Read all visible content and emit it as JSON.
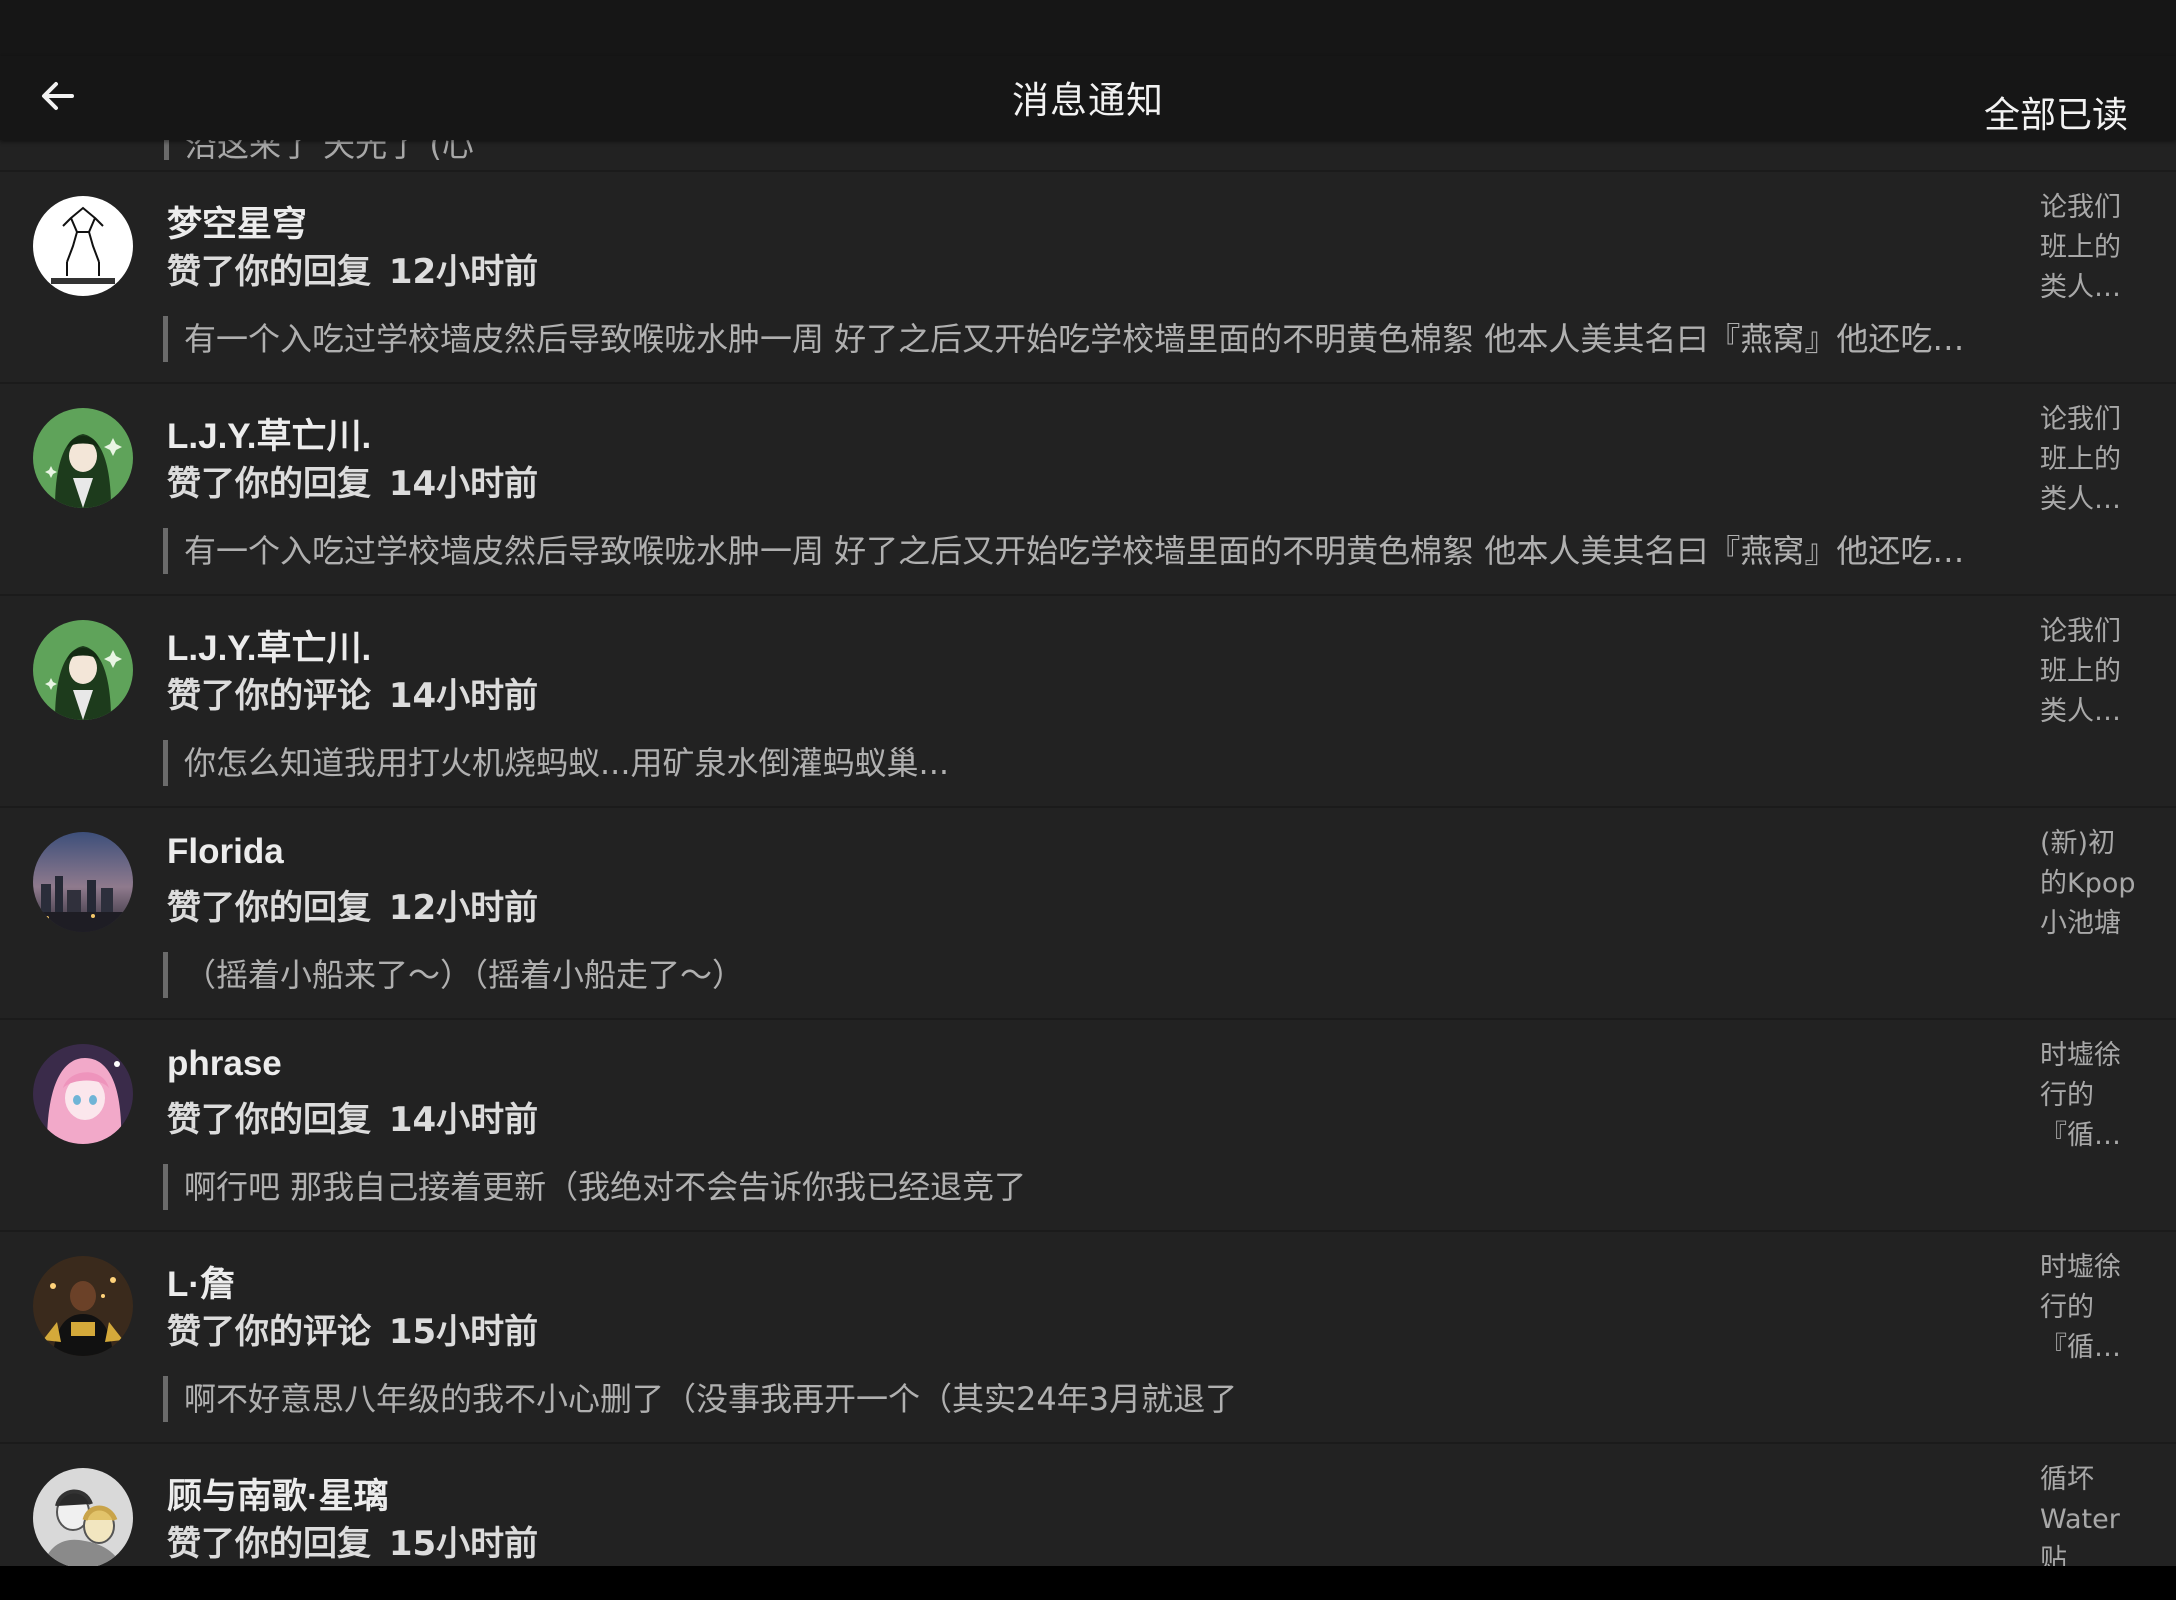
{
  "header": {
    "title": "消息通知",
    "mark_all_read": "全部已读",
    "back_icon": "arrow-left-icon"
  },
  "partial_item": {
    "quote": "沿这来了 天光了 (心"
  },
  "notifications": [
    {
      "avatar": "sketch-logo-avatar",
      "username": "梦空星穹",
      "action": "赞了你的回复",
      "time": "12小时前",
      "quote": "有一个入吃过学校墙皮然后导致喉咙水肿一周 好了之后又开始吃学校墙里面的不明黄色棉絮 他本人美其名曰『燕窝』他还吃…",
      "source": "论我们\n班上的\n类人…"
    },
    {
      "avatar": "green-anime-avatar",
      "username": "L.J.Y.草亡川.",
      "action": "赞了你的回复",
      "time": "14小时前",
      "quote": "有一个入吃过学校墙皮然后导致喉咙水肿一周 好了之后又开始吃学校墙里面的不明黄色棉絮 他本人美其名曰『燕窝』他还吃…",
      "source": "论我们\n班上的\n类人…"
    },
    {
      "avatar": "green-anime-avatar",
      "username": "L.J.Y.草亡川.",
      "action": "赞了你的评论",
      "time": "14小时前",
      "quote": "你怎么知道我用打火机烧蚂蚁...用矿泉水倒灌蚂蚁巢...",
      "source": "论我们\n班上的\n类人…"
    },
    {
      "avatar": "city-dusk-avatar",
      "username": "Florida",
      "action": "赞了你的回复",
      "time": "12小时前",
      "quote": "（摇着小船来了～）（摇着小船走了～）",
      "source": "(新)初\n的Kpop\n小池塘"
    },
    {
      "avatar": "pink-hair-avatar",
      "username": "phrase",
      "action": "赞了你的回复",
      "time": "14小时前",
      "quote": "啊行吧 那我自己接着更新（我绝对不会告诉你我已经退竞了",
      "source": "时墟徐\n行的\n『循…"
    },
    {
      "avatar": "basketball-player-avatar",
      "username": "L·詹",
      "action": "赞了你的评论",
      "time": "15小时前",
      "quote": "啊不好意思八年级的我不小心删了（没事我再开一个（其实24年3月就退了",
      "source": "时墟徐\n行的\n『循…"
    },
    {
      "avatar": "sketch-people-avatar",
      "username": "顾与南歌·星璃",
      "action": "赞了你的回复",
      "time": "15小时前",
      "quote": "",
      "source": "循坏\nWater\n贴"
    }
  ]
}
